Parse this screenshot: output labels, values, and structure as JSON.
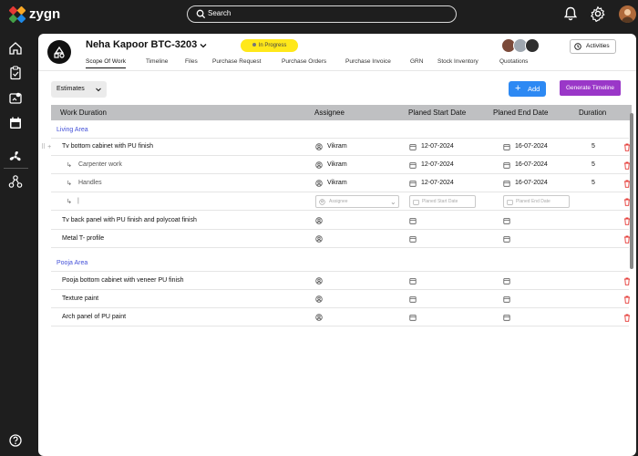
{
  "app": {
    "name": "zygn"
  },
  "search": {
    "placeholder": "Search"
  },
  "project": {
    "title": "Neha Kapoor BTC-3203",
    "status": "In Progress"
  },
  "activities_label": "Activities",
  "tabs": [
    "Scope Of Work",
    "Timeline",
    "Files",
    "Purchase Request",
    "Purchase Orders",
    "Purchase Invoice",
    "GRN",
    "Stock Inventory",
    "Quotations"
  ],
  "toolbar": {
    "estimates": "Estimates",
    "add": "Add",
    "generate": "Generate Timeline"
  },
  "columns": [
    "Work Duration",
    "Assignee",
    "Planed Start Date",
    "Planed End Date",
    "Duration"
  ],
  "sections": [
    {
      "name": "Living Area"
    },
    {
      "name": "Pooja Area"
    }
  ],
  "rows": [
    {
      "name": "Tv bottom cabinet with PU finish",
      "assignee": "Vikram",
      "start": "12-07-2024",
      "end": "16-07-2024",
      "duration": "5"
    },
    {
      "name": "Carpenter work",
      "assignee": "Vikram",
      "start": "12-07-2024",
      "end": "16-07-2024",
      "duration": "5"
    },
    {
      "name": "Handles",
      "assignee": "Vikram",
      "start": "12-07-2024",
      "end": "16-07-2024",
      "duration": "5"
    },
    {
      "name": "Tv back panel with PU finish and polycoat finish"
    },
    {
      "name": "Metal T- profile"
    },
    {
      "name": "Pooja bottom cabinet with veneer PU finish"
    },
    {
      "name": "Texture paint"
    },
    {
      "name": "Arch panel of PU paint"
    }
  ],
  "new_row": {
    "assignee_placeholder": "Assignee",
    "start_placeholder": "Planed Start Date",
    "end_placeholder": "Planed End Date"
  },
  "colors": {
    "accent": "#2d89f3",
    "generate": "#9a37c8",
    "status": "#ffe81a",
    "section": "#4350d8",
    "delete": "#e53935"
  }
}
